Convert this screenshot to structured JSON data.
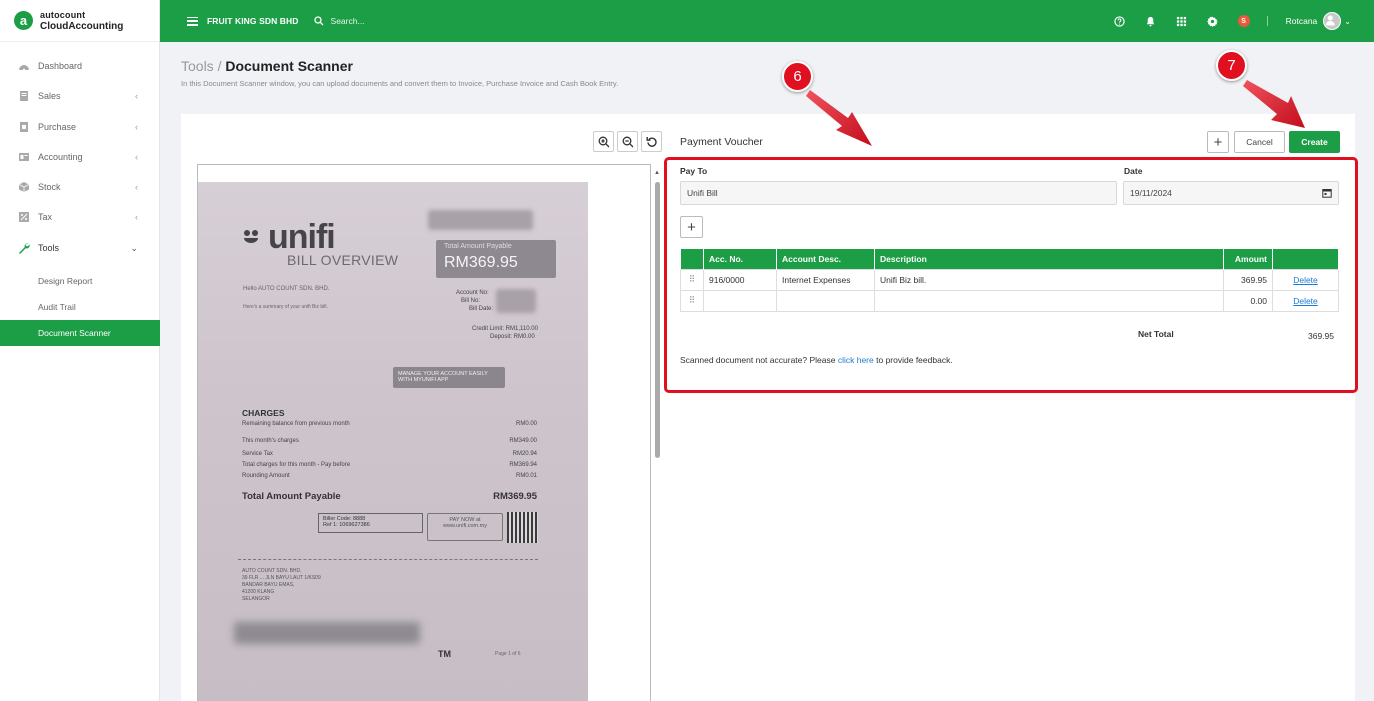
{
  "brand": {
    "top": "autocount",
    "bottom": "CloudAccounting",
    "letter": "a",
    "color": "#1b9e45"
  },
  "topbar": {
    "company": "FRUIT KING SDN BHD",
    "search_placeholder": "Search...",
    "badge": "S",
    "username": "Rotcana"
  },
  "sidebar": {
    "items": [
      {
        "label": "Dashboard",
        "icon": "dashboard-icon"
      },
      {
        "label": "Sales",
        "icon": "sales-icon"
      },
      {
        "label": "Purchase",
        "icon": "purchase-icon"
      },
      {
        "label": "Accounting",
        "icon": "accounting-icon"
      },
      {
        "label": "Stock",
        "icon": "stock-icon"
      },
      {
        "label": "Tax",
        "icon": "tax-icon"
      },
      {
        "label": "Tools",
        "icon": "wrench-icon"
      }
    ],
    "tools_sub": [
      "Design Report",
      "Audit Trail",
      "Document Scanner"
    ]
  },
  "page": {
    "breadcrumb_parent": "Tools",
    "breadcrumb_sep": "/",
    "breadcrumb_current": "Document Scanner",
    "subtitle": "In this Document Scanner window, you can upload documents and convert them to Invoice, Purchase Invoice and Cash Book Entry."
  },
  "document": {
    "brand": "unifi",
    "bill_overview": "BILL OVERVIEW",
    "total_label": "Total Amount Payable",
    "total_value": "RM369.95",
    "hello": "Hello AUTO COUNT SDN. BHD.",
    "summary": "Here's a summary of your unifi Biz bill.",
    "account_no": "Account No:",
    "bill_no": "Bill No:",
    "bill_date": "Bill Date:",
    "credit_limit": "Credit Limit: RM1,110.00",
    "deposit": "Deposit: RM0.00",
    "manage": "MANAGE YOUR ACCOUNT EASILY WITH MYUNIFI APP",
    "charges_title": "CHARGES",
    "charges": [
      {
        "label": "Remaining balance from previous month",
        "value": "RM0.00"
      },
      {
        "label": "This month's charges",
        "value": "RM349.00"
      },
      {
        "label": "Service Tax",
        "value": "RM20.94"
      },
      {
        "label": "Total charges for this month - Pay before",
        "value": "RM369.94"
      },
      {
        "label": "Rounding Amount",
        "value": "RM0.01"
      }
    ],
    "total_payable_label": "Total Amount Payable",
    "total_payable_value": "RM369.95",
    "biller_code": "Biller Code: 8888",
    "biller_ref": "Ref 1: 1069627386",
    "pay_now": "PAY NOW at",
    "pay_url": "www.unifi.com.my",
    "address": [
      "AUTO COUNT SDN. BHD.",
      "39 FLR ... JLN BAYU LAUT 1/KS09",
      "BANDAR BAYU EMAS,",
      "41200 KLANG",
      "SELANGOR"
    ],
    "tm": "TM",
    "page": "Page 1 of 6"
  },
  "form": {
    "title": "Payment Voucher",
    "add_label": "+",
    "cancel_label": "Cancel",
    "create_label": "Create",
    "pay_to_label": "Pay To",
    "pay_to_value": "Unifi Bill",
    "date_label": "Date",
    "date_value": "19/11/2024",
    "columns": [
      "",
      "Acc. No.",
      "Account Desc.",
      "Description",
      "Amount",
      ""
    ],
    "rows": [
      {
        "acc_no": "916/0000",
        "acc_desc": "Internet Expenses",
        "description": "Unifi Biz bill.",
        "amount": "369.95",
        "action": "Delete"
      },
      {
        "acc_no": "",
        "acc_desc": "",
        "description": "",
        "amount": "0.00",
        "action": "Delete"
      }
    ],
    "net_total_label": "Net Total",
    "net_total_value": "369.95",
    "feedback_pre": "Scanned document not accurate? Please",
    "feedback_link": "click here",
    "feedback_post": "to provide feedback."
  },
  "callouts": [
    "6",
    "7"
  ]
}
